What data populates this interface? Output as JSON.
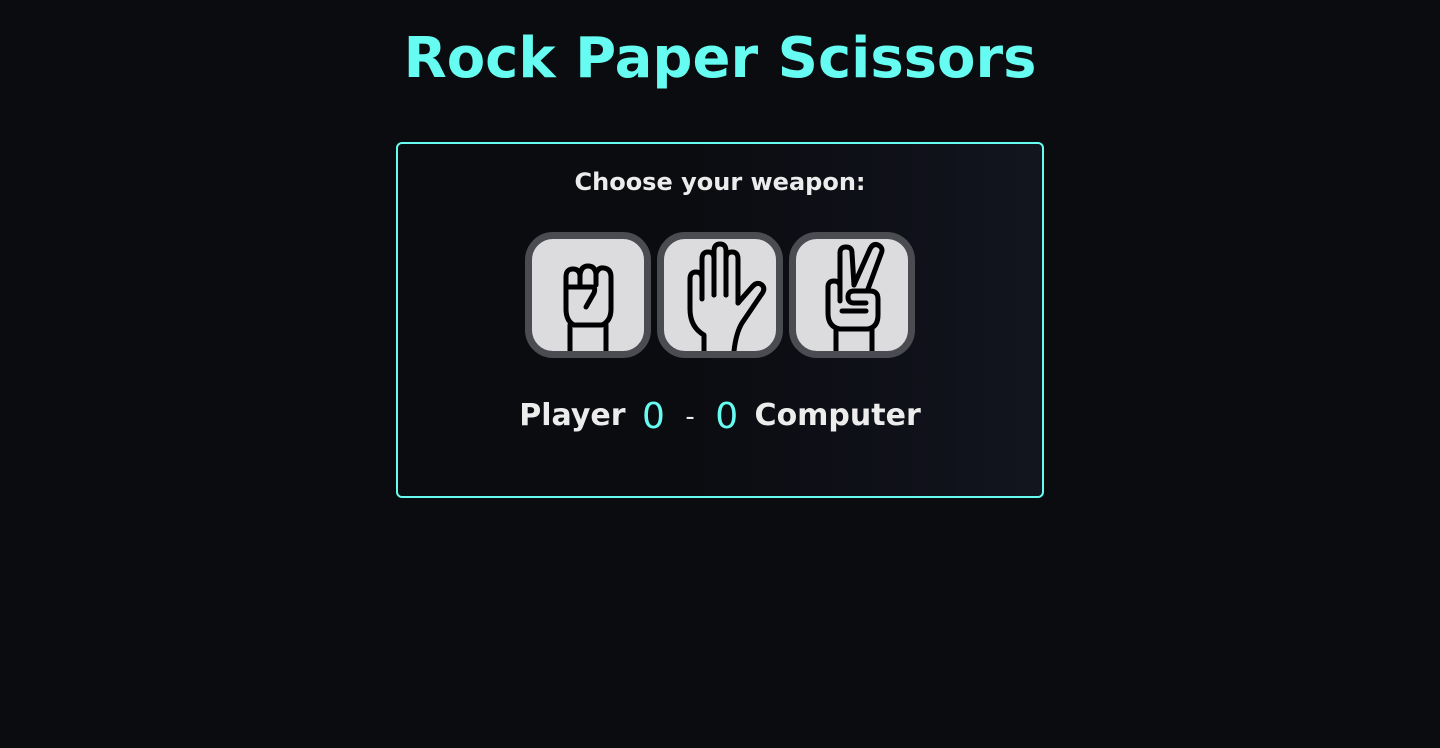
{
  "page": {
    "title": "Rock Paper Scissors",
    "accent_color": "#66fcf1",
    "background_color": "#0b0c10"
  },
  "game": {
    "prompt": "Choose your weapon:",
    "weapons": [
      {
        "name": "rock",
        "icon": "fist-icon"
      },
      {
        "name": "paper",
        "icon": "open-hand-icon"
      },
      {
        "name": "scissors",
        "icon": "peace-sign-icon"
      }
    ]
  },
  "score": {
    "player_label": "Player",
    "player_score": "0",
    "separator": "-",
    "computer_score": "0",
    "computer_label": "Computer"
  }
}
